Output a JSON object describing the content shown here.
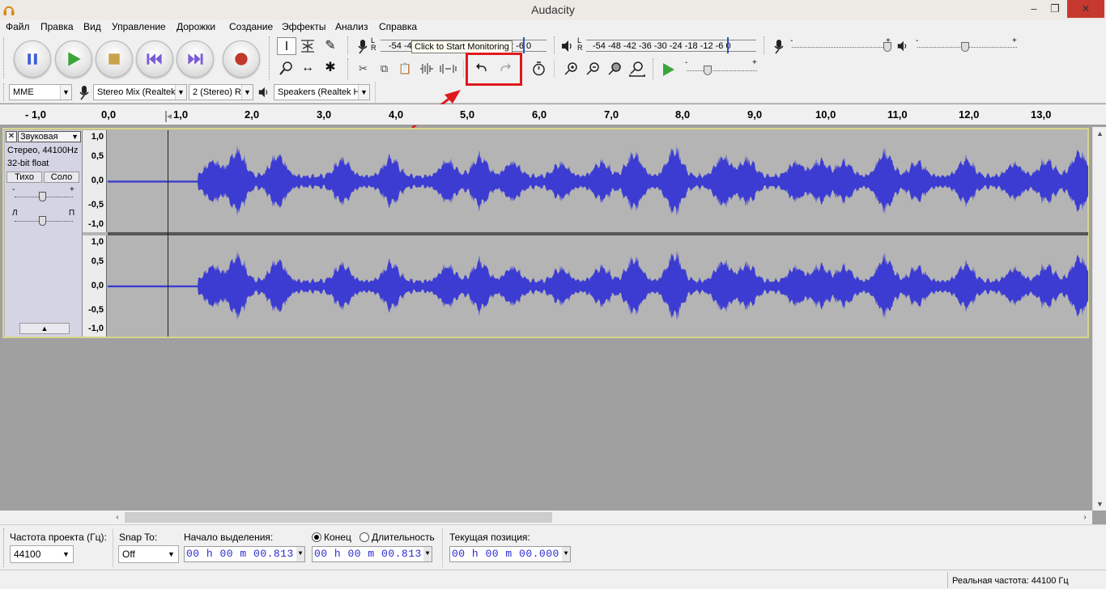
{
  "window": {
    "title": "Audacity",
    "minimize_glyph": "‒",
    "maximize_glyph": "❐",
    "close_glyph": "✕"
  },
  "menu": [
    "Файл",
    "Правка",
    "Вид",
    "Управление",
    "Дорожки",
    "Создание",
    "Эффекты",
    "Анализ",
    "Справка"
  ],
  "meters": {
    "record_scale": "-54 -4",
    "record_tail": "2 -6 0",
    "record_channels": "L\nR",
    "playback_scale": "-54 -48 -42 -36 -30 -24 -18 -12 -6 0",
    "playback_channels": "L\nR",
    "tooltip": "Click to Start Monitoring"
  },
  "mixer": {
    "minus": "-",
    "plus": "+"
  },
  "devices": {
    "host": "MME",
    "input": "Stereo Mix (Realtek",
    "channels": "2 (Stereo) R",
    "output": "Speakers (Realtek H"
  },
  "ruler": {
    "labels": [
      "- 1,0",
      "0,0",
      "1,0",
      "2,0",
      "3,0",
      "4,0",
      "5,0",
      "6,0",
      "7,0",
      "8,0",
      "9,0",
      "10,0",
      "11,0",
      "12,0",
      "13,0"
    ]
  },
  "track": {
    "close_glyph": "✕",
    "name": "Звуковая",
    "info_line1": "Стерео, 44100Hz",
    "info_line2": "32-bit float",
    "mute_label": "Тихо",
    "solo_label": "Соло",
    "gain_minus": "-",
    "gain_plus": "+",
    "pan_left": "Л",
    "pan_right": "П",
    "collapse_glyph": "▲",
    "vruler_labels": [
      "1,0",
      "0,5",
      "0,0",
      "-0,5",
      "-1,0"
    ]
  },
  "selection_bar": {
    "rate_label": "Частота проекта (Гц):",
    "rate_value": "44100",
    "snap_label": "Snap To:",
    "snap_value": "Off",
    "start_label": "Начало выделения:",
    "end_label": "Конец",
    "length_label": "Длительность",
    "position_label": "Текущая позиция:",
    "selection_start": "00 h 00 m 00.813 s",
    "selection_end": "00 h 00 m 00.813 s",
    "audio_position": "00 h 00 m 00.000 s",
    "end_selected": true
  },
  "status": {
    "actual_rate": "Реальная частота: 44100 Гц"
  },
  "colors": {
    "waveform": "#3c3cd2",
    "waveform_bg": "#b4b4b4",
    "highlight": "#e0191d",
    "play_green": "#3aa53a",
    "record_red": "#c0392b",
    "transport_blue": "#4060d0"
  }
}
